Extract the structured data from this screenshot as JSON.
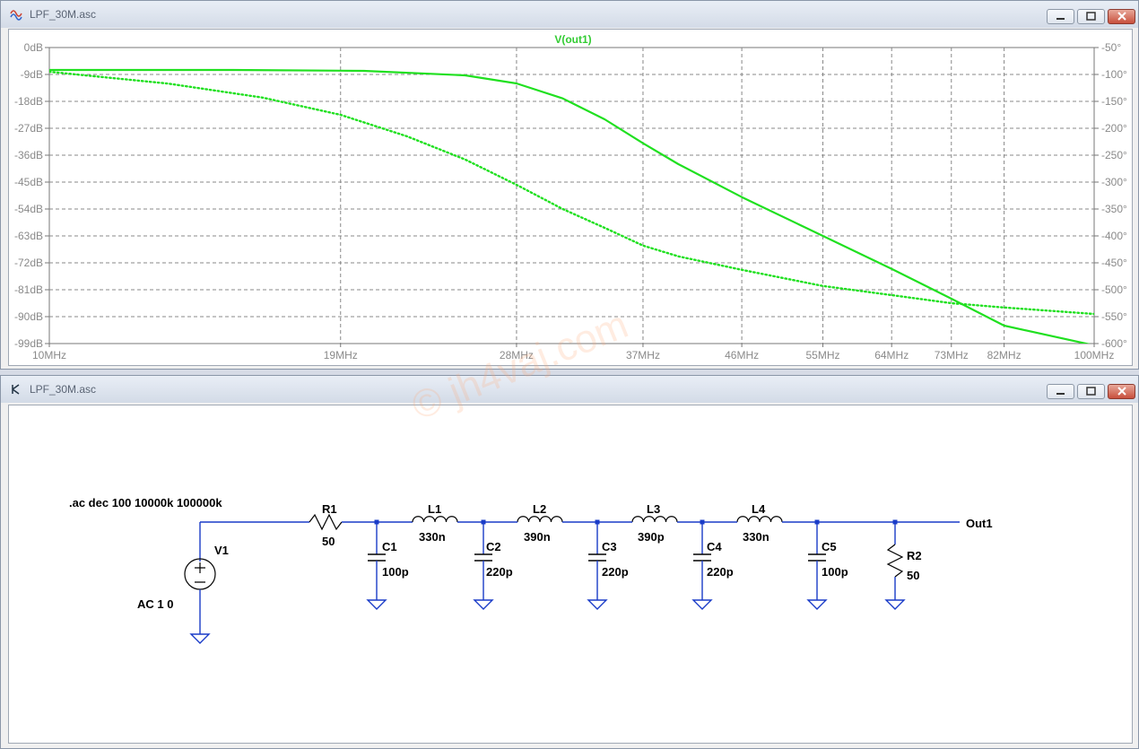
{
  "plot_window": {
    "title": "LPF_30M.asc",
    "trace_label": "V(out1)",
    "left_axis_ticks": [
      "0dB",
      "-9dB",
      "-18dB",
      "-27dB",
      "-36dB",
      "-45dB",
      "-54dB",
      "-63dB",
      "-72dB",
      "-81dB",
      "-90dB",
      "-99dB"
    ],
    "right_axis_ticks": [
      "-50°",
      "-100°",
      "-150°",
      "-200°",
      "-250°",
      "-300°",
      "-350°",
      "-400°",
      "-450°",
      "-500°",
      "-550°",
      "-600°"
    ],
    "x_axis_ticks": [
      {
        "label": "10MHz",
        "freq": 10
      },
      {
        "label": "19MHz",
        "freq": 19
      },
      {
        "label": "28MHz",
        "freq": 28
      },
      {
        "label": "37MHz",
        "freq": 37
      },
      {
        "label": "46MHz",
        "freq": 46
      },
      {
        "label": "55MHz",
        "freq": 55
      },
      {
        "label": "64MHz",
        "freq": 64
      },
      {
        "label": "73MHz",
        "freq": 73
      },
      {
        "label": "82MHz",
        "freq": 82
      },
      {
        "label": "100MHz",
        "freq": 100
      }
    ],
    "colors": {
      "trace": "#20e020",
      "axis_text": "#8a8a8a",
      "grid": "#7f7f7f",
      "label": "#33cc33"
    }
  },
  "chart_data": {
    "type": "line",
    "title": "V(out1)",
    "x_scale": "log",
    "xlim": [
      10,
      100
    ],
    "x_unit": "MHz",
    "y_left_lim": [
      -99,
      0
    ],
    "y_left_unit": "dB",
    "y_right_lim": [
      -600,
      -50
    ],
    "y_right_unit": "°",
    "grid": true,
    "series": [
      {
        "style": "solid",
        "axis": "left",
        "x": [
          10,
          15,
          20,
          25,
          28,
          31,
          34,
          37,
          40,
          46,
          55,
          64,
          73,
          82,
          100
        ],
        "values": [
          -7.5,
          -7.5,
          -7.8,
          -9.3,
          -12,
          -17,
          -24,
          -32,
          -39,
          -50,
          -63,
          -74,
          -84,
          -93,
          -106
        ]
      },
      {
        "style": "dotted",
        "axis": "right",
        "x": [
          10,
          13,
          16,
          19,
          22,
          25,
          28,
          31,
          34,
          37,
          40,
          46,
          55,
          64,
          73,
          82,
          100
        ],
        "values": [
          -95,
          -117,
          -143,
          -175,
          -215,
          -258,
          -305,
          -350,
          -385,
          -418,
          -438,
          -463,
          -493,
          -510,
          -525,
          -533,
          -545
        ]
      }
    ]
  },
  "schematic_window": {
    "title": "LPF_30M.asc",
    "directive": ".ac dec 100 10000k 100000k",
    "source": {
      "name": "V1",
      "value": "AC 1 0"
    },
    "components": [
      {
        "name": "R1",
        "value": "50"
      },
      {
        "name": "L1",
        "value": "330n"
      },
      {
        "name": "L2",
        "value": "390n"
      },
      {
        "name": "L3",
        "value": "390p"
      },
      {
        "name": "L4",
        "value": "330n"
      },
      {
        "name": "C1",
        "value": "100p"
      },
      {
        "name": "C2",
        "value": "220p"
      },
      {
        "name": "C3",
        "value": "220p"
      },
      {
        "name": "C4",
        "value": "220p"
      },
      {
        "name": "C5",
        "value": "100p"
      },
      {
        "name": "R2",
        "value": "50"
      }
    ],
    "net_label": "Out1",
    "watermark": "© jh4vaj.com",
    "colors": {
      "wire": "#1a3cc8",
      "ground": "#1a3cc8",
      "text": "#000000"
    }
  }
}
